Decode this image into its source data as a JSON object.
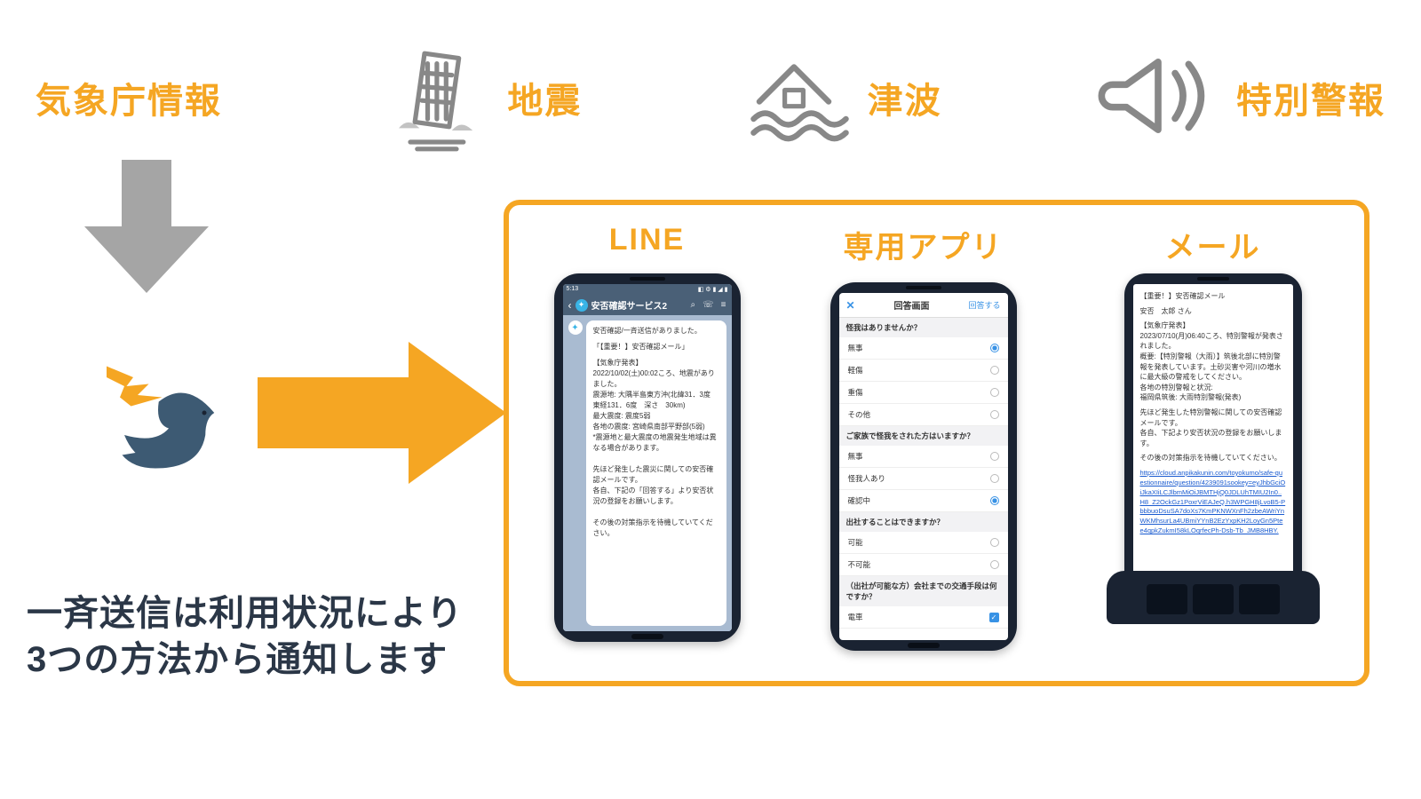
{
  "top": {
    "jma": "気象庁情報",
    "earthquake": "地震",
    "tsunami": "津波",
    "special": "特別警報"
  },
  "bottom_text_l1": "一斉送信は利用状況により",
  "bottom_text_l2": "3つの方法から通知します",
  "cols": {
    "line": "LINE",
    "app": "専用アプリ",
    "mail": "メール"
  },
  "line": {
    "status_time": "5:13",
    "nav_title": "安否確認サービス2",
    "bubble_head": "安否確認/一斉送信がありました。",
    "bubble_title": "「【重要！】安否確認メール」",
    "bubble_body": "【気象庁発表】\n2022/10/02(土)00:02ころ、地震がありました。\n震源地: 大隅半島東方沖(北緯31．3度　東経131．6度　深さ　30km)\n最大震度: 震度5弱\n各地の震度: 宮崎県南部平野部(5弱)\n*震源地と最大震度の地震発生地域は異なる場合があります。\n\n先ほど発生した震災に関しての安否確認メールです。\n各自、下記の「回答する」より安否状況の登録をお願いします。\n\nその後の対策指示を待機していてください。"
  },
  "app": {
    "nav_title": "回答画面",
    "nav_action": "回答する",
    "q1": "怪我はありませんか？",
    "q1_opts": [
      "無事",
      "軽傷",
      "重傷",
      "その他"
    ],
    "q2": "ご家族で怪我をされた方はいますか？",
    "q2_opts": [
      "無事",
      "怪我人あり",
      "確認中"
    ],
    "q3": "出社することはできますか？",
    "q3_opts": [
      "可能",
      "不可能"
    ],
    "q4": "（出社が可能な方）会社までの交通手段は何ですか？",
    "q4_opts": [
      "電車"
    ]
  },
  "mail": {
    "subject": "【重要！】安否確認メール",
    "name": "安否　太郎 さん",
    "body1": "【気象庁発表】\n2023/07/10(月)06:40ころ、特別警報が発表されました。\n概要:【特別警報（大雨）】筑後北部に特別警報を発表しています。土砂災害や河川の増水に最大級の警戒をしてください。\n各地の特別警報と状況:\n福岡県筑後: 大雨特別警報(発表)",
    "body2": "先ほど発生した特別警報に関しての安否確認メールです。\n各自、下記より安否状況の登録をお願いします。",
    "body3": "その後の対策指示を待機していてください。",
    "link": "https://cloud.anpikakunin.com/toyokumo/safe-questionnaire/question/4239091sookey=eyJhbGciOiJkaXIiLCJlbmMiOiJBMTHjQ0JDLUhTMIU2In0..H8_Z2OckGz1PoxrViEAJeQ.h3WPGH8jLvoB5-PbbbuoDsuSA7doXs7KmPKNWXnFh2zbeAWriYnWKMhsurLa4UBmiYYnB2EzYxpKH2LoyGn5Ptee4qpkZukmI58kLOqrfecPh-Dsb-Tb_JMB8HBY."
  }
}
